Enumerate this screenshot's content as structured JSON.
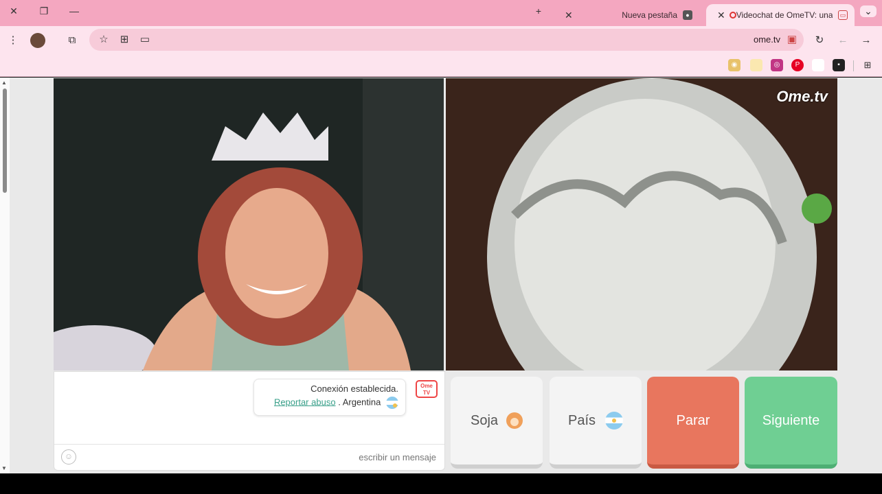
{
  "browser": {
    "tabs": [
      {
        "title": "Videochat de OmeTV: una",
        "active": true
      },
      {
        "title": "Nueva pestaña",
        "active": false
      }
    ],
    "url": "ome.tv",
    "colors": {
      "tabbar": "#f4a7c0",
      "toolbar": "#fde4ee"
    }
  },
  "video": {
    "watermark": "Ome.tv"
  },
  "chat": {
    "connection_text": "Conexión establecida.",
    "country": "Argentina",
    "separator": ".",
    "report_link": "Reportar abuso",
    "input_placeholder": "escribir un mensaje"
  },
  "controls": {
    "next_label": "Siguiente",
    "stop_label": "Parar",
    "country_label": "País",
    "gender_label": "Soja",
    "colors": {
      "next": "#6fcf93",
      "stop": "#e8765e",
      "neutral": "#f4f4f4"
    }
  }
}
